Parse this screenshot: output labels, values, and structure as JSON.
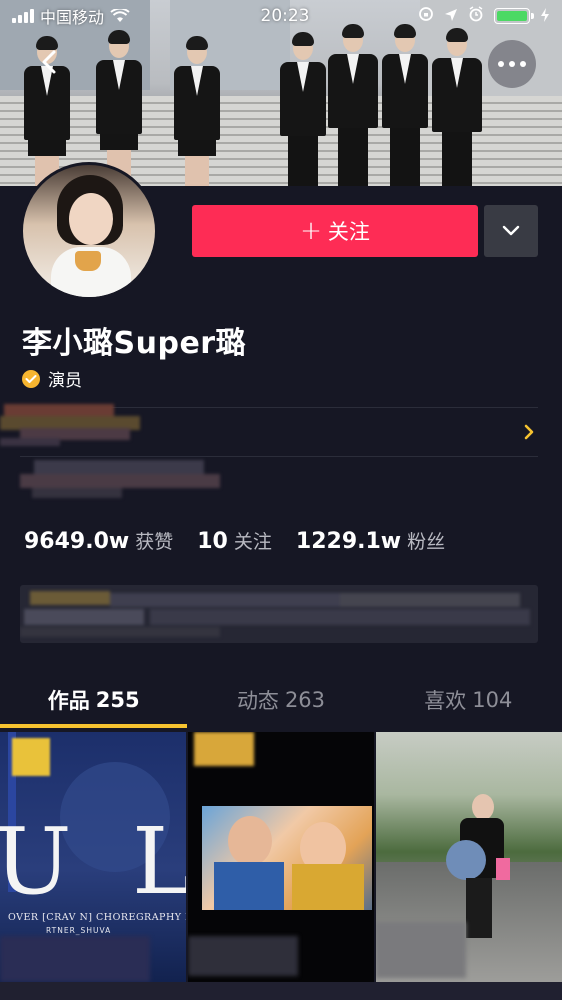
{
  "status_bar": {
    "carrier": "中国移动",
    "time": "20:23"
  },
  "profile": {
    "username": "李小璐Super璐",
    "verified_title": "演员",
    "follow_button": "关注"
  },
  "stats": [
    {
      "value": "9649.0w",
      "label": "获赞"
    },
    {
      "value": "10",
      "label": "关注"
    },
    {
      "value": "1229.1w",
      "label": "粉丝"
    }
  ],
  "tabs": [
    {
      "label": "作品",
      "count": "255",
      "active": true
    },
    {
      "label": "动态",
      "count": "263",
      "active": false
    },
    {
      "label": "喜欢",
      "count": "104",
      "active": false
    }
  ],
  "videos": [
    {
      "overlay_letters": [
        "U",
        "L"
      ],
      "caption": "OVER [CRAV N] CHOREGRAPHY BY",
      "caption_line2": "RTNER_SHUVA"
    },
    {
      "overlay_letters": [],
      "caption": "",
      "caption_line2": ""
    },
    {
      "overlay_letters": [],
      "caption": "",
      "caption_line2": ""
    }
  ],
  "colors": {
    "background": "#161724",
    "follow_button": "#fe2c55",
    "tab_indicator": "#f6c330",
    "verified_badge": "#f6b530",
    "battery": "#4cd964"
  },
  "icons": [
    "signal-icon",
    "wifi-icon",
    "rotation-lock-icon",
    "location-icon",
    "alarm-icon",
    "battery-icon",
    "charging-icon",
    "back-icon",
    "more-icon",
    "plus-icon",
    "chevron-down-icon",
    "verified-badge-icon",
    "chevron-right-icon"
  ]
}
